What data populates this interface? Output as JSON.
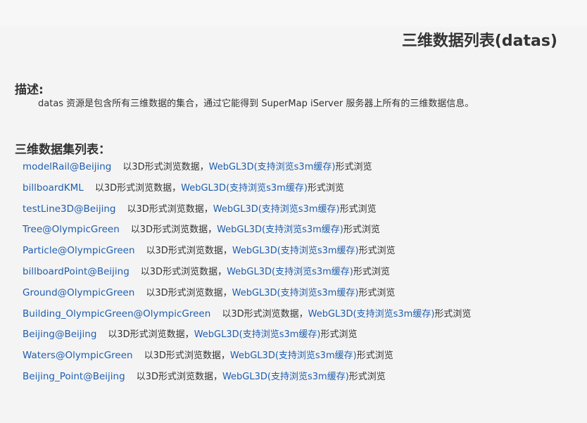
{
  "page": {
    "title": "三维数据列表(datas)"
  },
  "description": {
    "heading": "描述:",
    "text": "datas 资源是包含所有三维数据的集合，通过它能得到 SuperMap iServer 服务器上所有的三维数据信息。"
  },
  "dataset_list": {
    "heading": "三维数据集列表：",
    "view_3d_text": "以3D形式浏览数据，",
    "webgl_link": "WebGL3D(支持浏览s3m缓存)",
    "webgl_suffix": "形式浏览",
    "items": [
      {
        "name": "modelRail@Beijing"
      },
      {
        "name": "billboardKML"
      },
      {
        "name": "testLine3D@Beijing"
      },
      {
        "name": "Tree@OlympicGreen"
      },
      {
        "name": "Particle@OlympicGreen"
      },
      {
        "name": "billboardPoint@Beijing"
      },
      {
        "name": "Ground@OlympicGreen"
      },
      {
        "name": "Building_OlympicGreen@OlympicGreen"
      },
      {
        "name": "Beijing@Beijing"
      },
      {
        "name": "Waters@OlympicGreen"
      },
      {
        "name": "Beijing_Point@Beijing"
      }
    ]
  },
  "colors": {
    "link": "#1f5eae",
    "text": "#333333",
    "background": "#f4f4f4"
  }
}
